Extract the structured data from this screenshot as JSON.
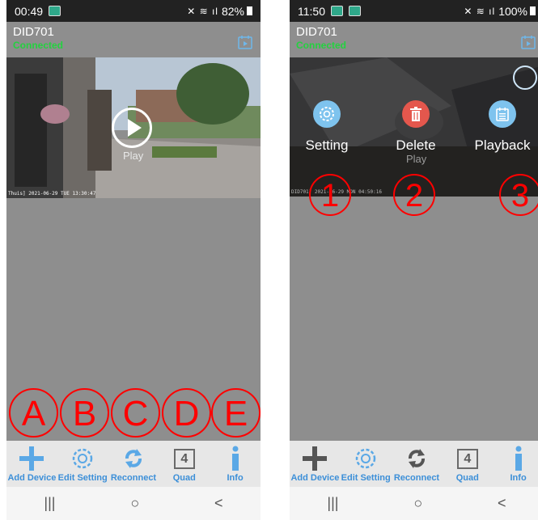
{
  "left": {
    "status": {
      "time": "00:49",
      "battery": "82%"
    },
    "device": {
      "name": "DID701",
      "status": "Connected"
    },
    "video": {
      "play_label": "Play",
      "timestamp": "Thuis] 2021-06-29 TUE 13:30:47"
    },
    "markers": [
      "A",
      "B",
      "C",
      "D",
      "E"
    ]
  },
  "right": {
    "status": {
      "time": "11:50",
      "battery": "100%"
    },
    "device": {
      "name": "DID701",
      "status": "Connected"
    },
    "video": {
      "play_label": "Play",
      "timestamp": "DID701] 2021-06-29 MON 04:50:16"
    },
    "actions": {
      "setting": "Setting",
      "delete": "Delete",
      "playback": "Playback"
    },
    "markers": [
      "1",
      "2",
      "3"
    ]
  },
  "toolbar": {
    "add_device": "Add Device",
    "edit_setting": "Edit Setting",
    "reconnect": "Reconnect",
    "quad": "Quad",
    "quad_number": "4",
    "info": "Info"
  },
  "navbar": {
    "recent": "|||",
    "home": "○",
    "back": "<"
  },
  "colors": {
    "accent": "#3c8fd8",
    "connected": "#23d23f",
    "marker": "#ff0000",
    "delete": "#e4574d",
    "setting": "#7ec3ee"
  },
  "icons": {
    "calendar": "calendar-play-icon",
    "add": "plus-icon",
    "settings": "gear-icon",
    "reconnect": "refresh-icon",
    "quad": "quad-grid-icon",
    "info": "info-icon",
    "trash": "trash-icon"
  }
}
